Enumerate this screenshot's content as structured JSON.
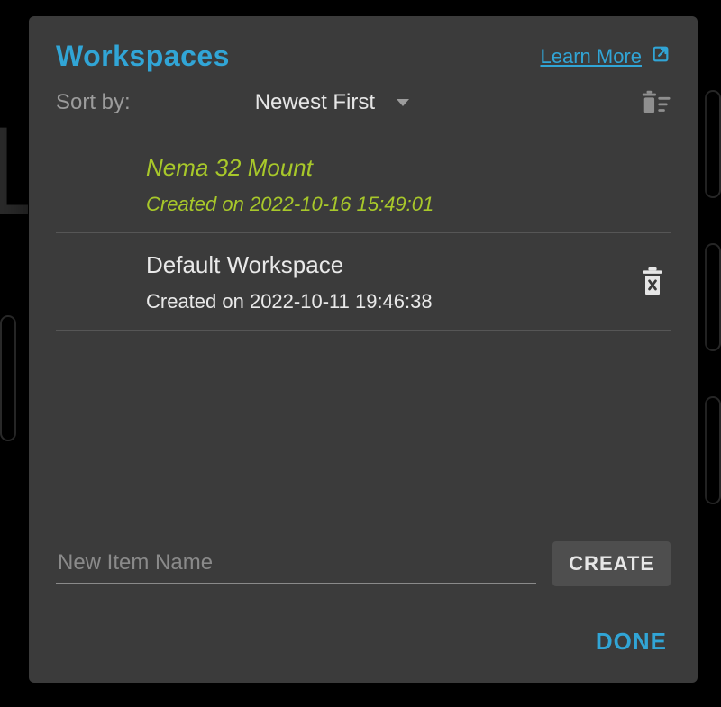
{
  "header": {
    "title": "Workspaces",
    "learn_more": "Learn More"
  },
  "sort": {
    "label": "Sort by:",
    "selected": "Newest First"
  },
  "icons": {
    "external": "external-link-icon",
    "dropdown": "chevron-down-icon",
    "clear_all": "clear-list-icon",
    "delete": "trash-icon"
  },
  "workspaces": [
    {
      "name": "Nema 32 Mount",
      "meta": "Created on 2022-10-16 15:49:01",
      "active": true,
      "deletable": false
    },
    {
      "name": "Default Workspace",
      "meta": "Created on 2022-10-11 19:46:38",
      "active": false,
      "deletable": true
    }
  ],
  "new_item": {
    "placeholder": "New Item Name",
    "create_label": "CREATE"
  },
  "footer": {
    "done_label": "DONE"
  },
  "colors": {
    "accent_blue": "#31a5d6",
    "accent_green": "#a8c82a",
    "panel_bg": "#3b3b3b"
  }
}
